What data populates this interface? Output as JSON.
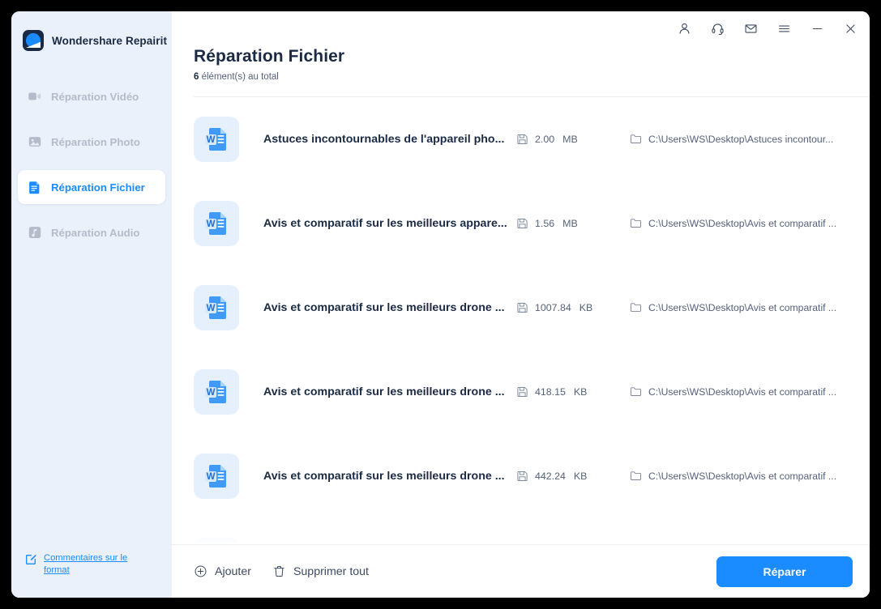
{
  "sidebar": {
    "brand": "Wondershare Repairit",
    "logo_icon": "repairit-logo-icon",
    "items": [
      {
        "label": "Réparation Vidéo",
        "icon": "video-camera-icon",
        "active": false
      },
      {
        "label": "Réparation Photo",
        "icon": "photo-icon",
        "active": false
      },
      {
        "label": "Réparation Fichier",
        "icon": "document-icon",
        "active": true
      },
      {
        "label": "Réparation Audio",
        "icon": "music-note-icon",
        "active": false
      }
    ],
    "feedback": {
      "label": "Commentaires sur le format",
      "icon": "edit-square-icon"
    }
  },
  "titlebar": {
    "buttons": [
      {
        "name": "account-icon",
        "title": "Compte"
      },
      {
        "name": "headset-icon",
        "title": "Support"
      },
      {
        "name": "mail-icon",
        "title": "Messages"
      },
      {
        "name": "hamburger-menu-icon",
        "title": "Menu"
      },
      {
        "name": "minimize-icon",
        "title": "Réduire"
      },
      {
        "name": "close-icon",
        "title": "Fermer"
      }
    ]
  },
  "header": {
    "title": "Réparation Fichier",
    "count": "6",
    "count_suffix": "élément(s) au total"
  },
  "files": [
    {
      "name": "Astuces incontournables de l'appareil pho...",
      "size_value": "2.00",
      "size_unit": "MB",
      "path": "C:\\Users\\WS\\Desktop\\Astuces incontour...",
      "icon": "word-document-icon"
    },
    {
      "name": "Avis et comparatif sur les meilleurs appare...",
      "size_value": "1.56",
      "size_unit": "MB",
      "path": "C:\\Users\\WS\\Desktop\\Avis et comparatif ...",
      "icon": "word-document-icon"
    },
    {
      "name": "Avis et comparatif sur les meilleurs drone ...",
      "size_value": "1007.84",
      "size_unit": "KB",
      "path": "C:\\Users\\WS\\Desktop\\Avis et comparatif ...",
      "icon": "word-document-icon"
    },
    {
      "name": "Avis et comparatif sur les meilleurs drone ...",
      "size_value": "418.15",
      "size_unit": "KB",
      "path": "C:\\Users\\WS\\Desktop\\Avis et comparatif ...",
      "icon": "word-document-icon"
    },
    {
      "name": "Avis et comparatif sur les meilleurs drone ...",
      "size_value": "442.24",
      "size_unit": "KB",
      "path": "C:\\Users\\WS\\Desktop\\Avis et comparatif ...",
      "icon": "word-document-icon"
    },
    {
      "name": "",
      "size_value": "",
      "size_unit": "",
      "path": "",
      "icon": "word-document-icon"
    }
  ],
  "footer": {
    "add_label": "Ajouter",
    "add_icon": "plus-circle-icon",
    "delete_all_label": "Supprimer tout",
    "delete_all_icon": "trash-icon",
    "repair_label": "Réparer"
  },
  "colors": {
    "accent": "#1a8cff",
    "sidebar_bg": "#eaf1fb",
    "text_dark": "#1b2a44",
    "text_muted": "#55617a",
    "nav_inactive": "#b4bcc9",
    "file_icon_bg": "#e6effc"
  }
}
